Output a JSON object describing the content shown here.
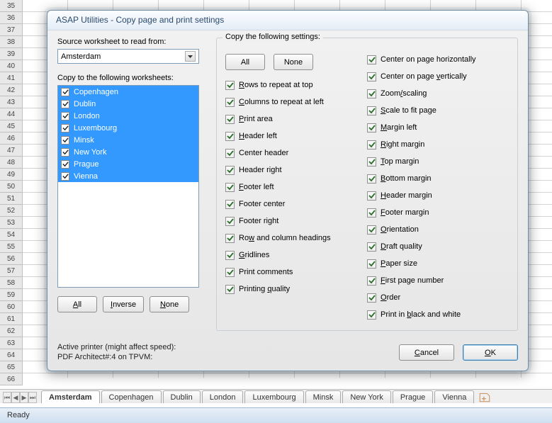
{
  "excel": {
    "row_start": 35,
    "row_end": 66,
    "status": "Ready",
    "active_tab": "Amsterdam",
    "tabs": [
      "Amsterdam",
      "Copenhagen",
      "Dublin",
      "London",
      "Luxembourg",
      "Minsk",
      "New York",
      "Prague",
      "Vienna"
    ]
  },
  "dialog": {
    "title": "ASAP Utilities - Copy page and print settings",
    "source_label": "Source worksheet to read from:",
    "source_value": "Amsterdam",
    "copy_to_label": "Copy to the following worksheets:",
    "worksheets": [
      "Copenhagen",
      "Dublin",
      "London",
      "Luxembourg",
      "Minsk",
      "New York",
      "Prague",
      "Vienna"
    ],
    "left_buttons": {
      "all": "All",
      "inverse": "Inverse",
      "none": "None"
    },
    "printer_line1": "Active printer (might affect speed):",
    "printer_line2": "PDF Architect#:4 on TPVM:",
    "settings_group_label": "Copy the following settings:",
    "settings_buttons": {
      "all": "All",
      "none": "None"
    },
    "settings_left": [
      {
        "label": "Rows to repeat at top",
        "u": "R"
      },
      {
        "label": "Columns to repeat at left",
        "u": "C"
      },
      {
        "label": "Print area",
        "u": "P"
      },
      {
        "label": "Header left",
        "u": "H"
      },
      {
        "label": "Center header",
        "u": null
      },
      {
        "label": "Header right",
        "u": null
      },
      {
        "label": "Footer left",
        "u": "F"
      },
      {
        "label": "Footer center",
        "u": null
      },
      {
        "label": "Footer right",
        "u": null
      },
      {
        "label": "Row and column headings",
        "u": "w"
      },
      {
        "label": "Gridlines",
        "u": "G"
      },
      {
        "label": "Print comments",
        "u": null
      },
      {
        "label": "Printing quality",
        "u": "q"
      }
    ],
    "settings_right": [
      {
        "label": "Center on page horizontally",
        "u": null
      },
      {
        "label": "Center on page vertically",
        "u": "v"
      },
      {
        "label": "Zoom/scaling",
        "u": "/"
      },
      {
        "label": "Scale to fit page",
        "u": "S"
      },
      {
        "label": "Margin left",
        "u": "M"
      },
      {
        "label": "Right margin",
        "u": "R"
      },
      {
        "label": "Top margin",
        "u": "T"
      },
      {
        "label": "Bottom margin",
        "u": "B"
      },
      {
        "label": "Header margin",
        "u": "H"
      },
      {
        "label": "Footer margin",
        "u": "F"
      },
      {
        "label": "Orientation",
        "u": "O"
      },
      {
        "label": "Draft quality",
        "u": "D"
      },
      {
        "label": "Paper size",
        "u": "P"
      },
      {
        "label": "First page number",
        "u": "F"
      },
      {
        "label": "Order",
        "u": "O"
      },
      {
        "label": "Print in black and white",
        "u": "b"
      }
    ],
    "buttons": {
      "cancel": "Cancel",
      "ok": "OK"
    }
  }
}
